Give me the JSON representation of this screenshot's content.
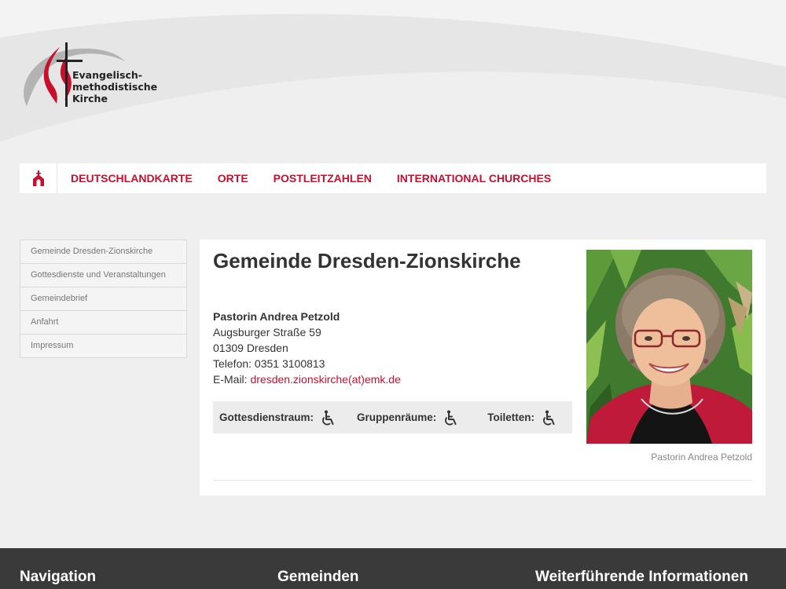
{
  "brand": {
    "logo_lines": [
      "Evangelisch-",
      "methodistische",
      "Kirche"
    ],
    "accent_color": "#c8102e"
  },
  "topnav": {
    "home_icon": "church-icon",
    "items": [
      "DEUTSCHLANDKARTE",
      "ORTE",
      "POSTLEITZAHLEN",
      "INTERNATIONAL CHURCHES"
    ]
  },
  "sidebar": {
    "items": [
      "Gemeinde Dresden-Zionskirche",
      "Gottesdienste und Veranstaltungen",
      "Gemeindebrief",
      "Anfahrt",
      "Impressum"
    ]
  },
  "main": {
    "title": "Gemeinde Dresden-Zionskirche",
    "contact": {
      "name": "Pastorin Andrea Petzold",
      "street": "Augsburger Straße 59",
      "city": "01309 Dresden",
      "phone": "Telefon: 0351 3100813",
      "email_label": "E-Mail: ",
      "email": "dresden.zionskirche(at)emk.de"
    },
    "accessibility": [
      {
        "label": "Gottesdienstraum:",
        "icon": "wheelchair-icon"
      },
      {
        "label": "Gruppenräume:",
        "icon": "wheelchair-icon"
      },
      {
        "label": "Toiletten:",
        "icon": "wheelchair-icon"
      }
    ],
    "photo_caption": "Pastorin Andrea Petzold"
  },
  "footer": {
    "headings": [
      "Navigation",
      "Gemeinden",
      "Weiterführende Informationen"
    ]
  }
}
